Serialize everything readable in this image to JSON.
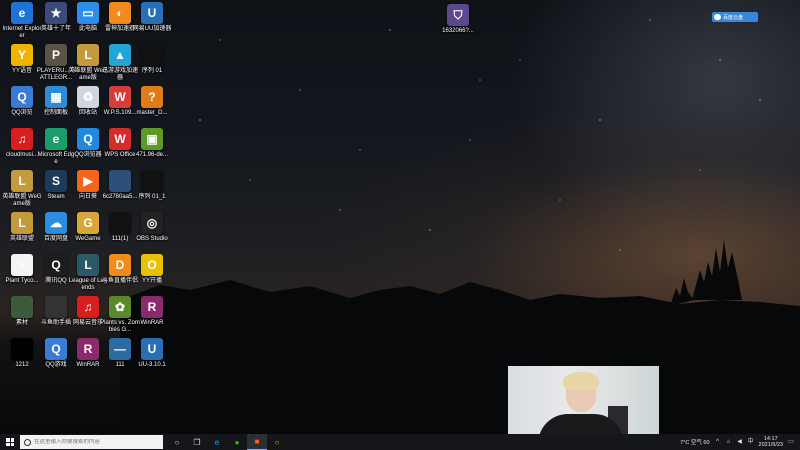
{
  "desktop_icons": [
    {
      "label": "Internet Explorer",
      "icon": "internet-explorer-icon",
      "color": "#1e73d8",
      "glyph": "e"
    },
    {
      "label": "英雄十了年",
      "icon": "game-hero-icon",
      "color": "#3a4a7a",
      "glyph": "★"
    },
    {
      "label": "此电脑",
      "icon": "computer-icon",
      "color": "#2c8ee8",
      "glyph": "▭"
    },
    {
      "label": "雷神加速器",
      "icon": "leishen-accelerator-icon",
      "color": "#f28a1c",
      "glyph": "◐"
    },
    {
      "label": "网易UU加速器",
      "icon": "uu-accelerator-icon",
      "color": "#2a6fb5",
      "glyph": "U"
    },
    {
      "label": "YY语音",
      "icon": "yy-voice-icon",
      "color": "#f0b400",
      "glyph": "Y"
    },
    {
      "label": "PLAYERU... BATTLEGR...",
      "icon": "pubg-icon",
      "color": "#5a5448",
      "glyph": "P"
    },
    {
      "label": "英雄联盟 WeGame版",
      "icon": "league-wegame-icon",
      "color": "#c59a3a",
      "glyph": "L"
    },
    {
      "label": "迅游游戏加速器",
      "icon": "xunyou-accelerator-icon",
      "color": "#1fa7d8",
      "glyph": "▲"
    },
    {
      "label": "序列 01",
      "icon": "video-file-icon",
      "color": "#111111",
      "glyph": ""
    },
    {
      "label": "QQ浏览",
      "icon": "qq-game-icon",
      "color": "#3a7bd5",
      "glyph": "Q"
    },
    {
      "label": "控制面板",
      "icon": "control-panel-icon",
      "color": "#2f8bd6",
      "glyph": "▦"
    },
    {
      "label": "回收站",
      "icon": "recycle-bin-icon",
      "color": "#cfd6dd",
      "glyph": "♻"
    },
    {
      "label": "W.P.S.109...",
      "icon": "wps-file-icon",
      "color": "#d93b3b",
      "glyph": "W"
    },
    {
      "label": "master_D...",
      "icon": "archive-icon",
      "color": "#e07b1a",
      "glyph": "?"
    },
    {
      "label": "cloudmusi...",
      "icon": "netease-music-icon",
      "color": "#d81e1e",
      "glyph": "♫"
    },
    {
      "label": "Microsoft Edge",
      "icon": "edge-icon",
      "color": "#1a9e6e",
      "glyph": "e"
    },
    {
      "label": "QQ浏览器",
      "icon": "qq-browser-icon",
      "color": "#1f8ae0",
      "glyph": "Q"
    },
    {
      "label": "WPS Office",
      "icon": "wps-office-icon",
      "color": "#d42b2b",
      "glyph": "W"
    },
    {
      "label": "471.96-de...",
      "icon": "nvidia-driver-icon",
      "color": "#5e9a26",
      "glyph": "▣"
    },
    {
      "label": "英雄联盟 WeGame版",
      "icon": "league-wegame-icon",
      "color": "#c59a3a",
      "glyph": "L"
    },
    {
      "label": "Steam",
      "icon": "steam-icon",
      "color": "#1b3a5c",
      "glyph": "S"
    },
    {
      "label": "向日葵",
      "icon": "sunflower-icon",
      "color": "#f2651c",
      "glyph": "▶"
    },
    {
      "label": "6c2780aa5...",
      "icon": "image-file-icon",
      "color": "#2b4f7a",
      "glyph": ""
    },
    {
      "label": "序列 01_1",
      "icon": "video-file-icon",
      "color": "#111111",
      "glyph": ""
    },
    {
      "label": "英雄联盟",
      "icon": "league-icon",
      "color": "#c59a3a",
      "glyph": "L"
    },
    {
      "label": "百度网盘",
      "icon": "baidu-netdisk-icon",
      "color": "#2a8de0",
      "glyph": "☁"
    },
    {
      "label": "WeGame",
      "icon": "wegame-icon",
      "color": "#d9a63a",
      "glyph": "G"
    },
    {
      "label": "111(1)",
      "icon": "video-file-icon",
      "color": "#111111",
      "glyph": ""
    },
    {
      "label": "OBS Studio",
      "icon": "obs-icon",
      "color": "#222222",
      "glyph": "◎"
    },
    {
      "label": "Plant Tyco...",
      "icon": "document-icon",
      "color": "#f4f4f4",
      "glyph": "≡"
    },
    {
      "label": "腾讯QQ",
      "icon": "qq-icon",
      "color": "#1d1d1d",
      "glyph": "Q"
    },
    {
      "label": "League of Legends",
      "icon": "league-icon",
      "color": "#2a5a6a",
      "glyph": "L"
    },
    {
      "label": "斗鱼直播伴侣",
      "icon": "douyu-icon",
      "color": "#f28a1c",
      "glyph": "D"
    },
    {
      "label": "YY开播",
      "icon": "yy-live-icon",
      "color": "#e6c200",
      "glyph": "O"
    },
    {
      "label": "素材",
      "icon": "image-file-icon",
      "color": "#3d5a3a",
      "glyph": ""
    },
    {
      "label": "斗鱼助手插",
      "icon": "document-icon",
      "color": "#333333",
      "glyph": ""
    },
    {
      "label": "网易云音乐",
      "icon": "netease-music-icon",
      "color": "#d81e1e",
      "glyph": "♫"
    },
    {
      "label": "Plants vs. Zombies G...",
      "icon": "plants-vs-zombies-icon",
      "color": "#5a8a2a",
      "glyph": "✿"
    },
    {
      "label": "WinRAR",
      "icon": "winrar-icon",
      "color": "#8a2a6a",
      "glyph": "R"
    },
    {
      "label": "1212",
      "icon": "blank-file-icon",
      "color": "#000000",
      "glyph": ""
    },
    {
      "label": "QQ游戏",
      "icon": "qq-game-icon",
      "color": "#3a7bd5",
      "glyph": "Q"
    },
    {
      "label": "WinRAR",
      "icon": "winrar-icon",
      "color": "#8a2a6a",
      "glyph": "R"
    },
    {
      "label": "111",
      "icon": "video-file-icon",
      "color": "#2c6aa0",
      "glyph": "—"
    },
    {
      "label": "UU-3.10.1",
      "icon": "uu-installer-icon",
      "color": "#2a6fb5",
      "glyph": "U"
    }
  ],
  "top_file": {
    "label": "1632066?...",
    "icon": "app-shortcut-icon",
    "color": "#5a4a8a"
  },
  "cloud_badge": {
    "label": "百度云盘"
  },
  "taskbar": {
    "search_placeholder": "在这里输入你要搜索的内容",
    "apps": [
      {
        "icon": "cortana-icon",
        "glyph": "○",
        "color": "#dddddd"
      },
      {
        "icon": "task-view-icon",
        "glyph": "❐",
        "color": "#dddddd"
      },
      {
        "icon": "edge-taskbar-icon",
        "glyph": "e",
        "color": "#2b9bd8"
      },
      {
        "icon": "wechat-icon",
        "glyph": "●",
        "color": "#2dc100"
      },
      {
        "icon": "sunflower-taskbar-icon",
        "glyph": "■",
        "color": "#f2651c"
      },
      {
        "icon": "yy-taskbar-icon",
        "glyph": "○",
        "color": "#e6c200"
      }
    ],
    "weather": "7°C 空气 60",
    "time": "14:17",
    "date": "2021/9/23"
  }
}
